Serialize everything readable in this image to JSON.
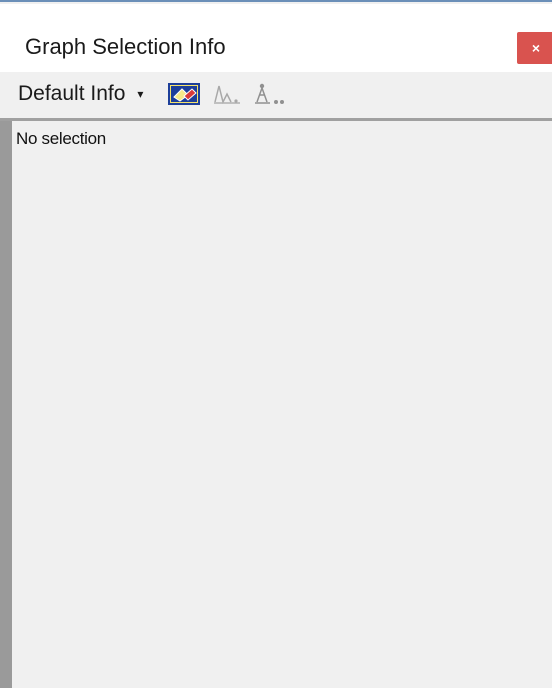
{
  "window": {
    "title": "Graph Selection Info",
    "close_label": "×"
  },
  "toolbar": {
    "dropdown_label": "Default Info",
    "dropdown_caret": "▾",
    "icons": [
      "edit-selection-icon",
      "graph-peaks-icon",
      "tree-nodes-icon"
    ]
  },
  "content": {
    "status_text": "No selection"
  }
}
